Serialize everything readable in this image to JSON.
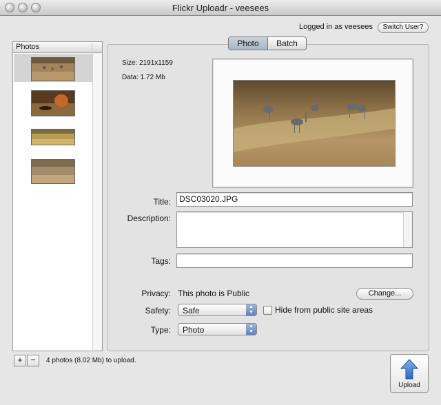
{
  "window": {
    "title": "Flickr Uploadr - veesees"
  },
  "account": {
    "status": "Logged in as veesees",
    "switch_label": "Switch User?"
  },
  "sidebar": {
    "header": "Photos",
    "thumbnails": [
      {
        "name": "cranes in field thumbnail"
      },
      {
        "name": "dog running thumbnail"
      },
      {
        "name": "grass field thumbnail"
      },
      {
        "name": "dry grass thumbnail"
      }
    ]
  },
  "tabs": [
    {
      "label": "Photo",
      "active": true
    },
    {
      "label": "Batch",
      "active": false
    }
  ],
  "photo_info": {
    "size": "Size:  2191x1159",
    "data": "Data:  1.72 Mb"
  },
  "fields": {
    "title_label": "Title:",
    "title_value": "DSC03020.JPG",
    "description_label": "Description:",
    "description_value": "",
    "tags_label": "Tags:",
    "tags_value": ""
  },
  "privacy": {
    "label": "Privacy:",
    "value": "This photo is Public",
    "change_label": "Change..."
  },
  "safety": {
    "label": "Safety:",
    "value": "Safe",
    "hide_label": "Hide from public site areas",
    "hide_checked": false
  },
  "type": {
    "label": "Type:",
    "value": "Photo"
  },
  "footer": {
    "add_label": "+",
    "remove_label": "−",
    "status": "4 photos (8.02 Mb) to upload.",
    "upload_label": "Upload"
  },
  "colors": {
    "accent": "#4a86d0",
    "selection": "#d4d4d4"
  }
}
